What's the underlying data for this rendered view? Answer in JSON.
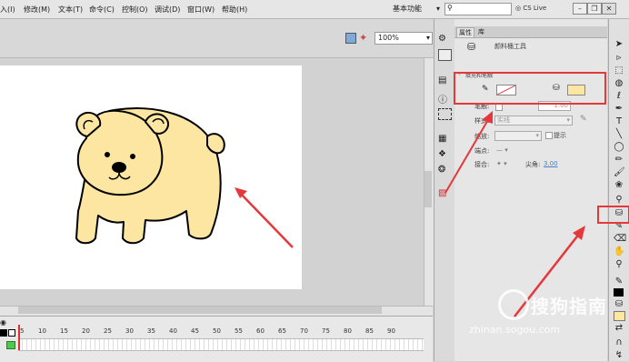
{
  "menubar": {
    "items": [
      "入(I)",
      "修改(M)",
      "文本(T)",
      "命令(C)",
      "控制(O)",
      "调试(D)",
      "窗口(W)",
      "帮助(H)"
    ],
    "workspace": "基本功能",
    "search_placeholder": "",
    "cs_live": "CS Live"
  },
  "stage_toolbar": {
    "zoom": "100%"
  },
  "timeline": {
    "frame_numbers": [
      "5",
      "10",
      "15",
      "20",
      "25",
      "30",
      "35",
      "40",
      "45",
      "50",
      "55",
      "60",
      "65",
      "70",
      "75",
      "80",
      "85",
      "90"
    ]
  },
  "properties": {
    "tab_properties": "属性",
    "tab_library": "库",
    "tool_name": "颜料桶工具",
    "section_fill_stroke": "填充和笔触",
    "stroke_label": "笔触:",
    "stroke_value": "1.00",
    "style_label": "样式:",
    "style_value": "实线",
    "scale_label": "缩放:",
    "hint_label": "提示",
    "cap_label": "端点:",
    "join_label": "接合:",
    "miter_label": "尖角:",
    "miter_value": "3.00",
    "fill_color": "#fde6a2"
  },
  "watermark": {
    "text": "搜狗指南",
    "url": "zhinan.sogou.com"
  },
  "colors": {
    "annotation": "#e4383b",
    "bear_fill": "#fde6a2",
    "stroke_color": "#000000"
  }
}
